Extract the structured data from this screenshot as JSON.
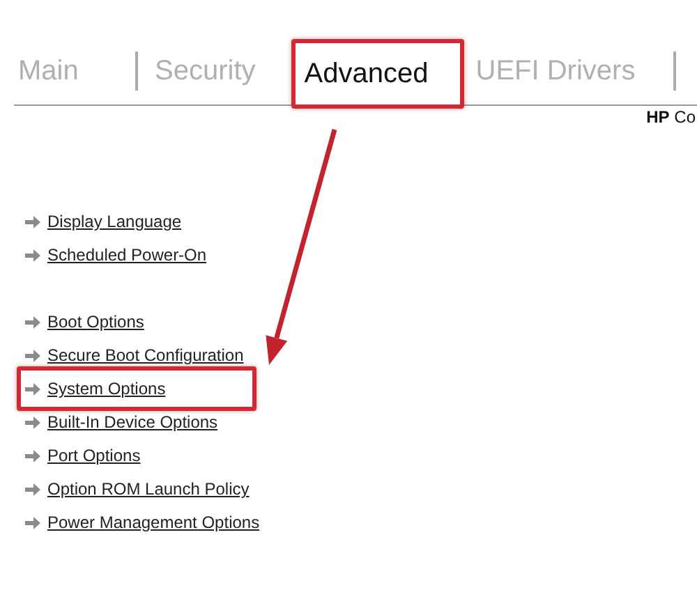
{
  "tabs": [
    {
      "label": "Main",
      "selected": false
    },
    {
      "label": "Security",
      "selected": false
    },
    {
      "label": "Advanced",
      "selected": true
    },
    {
      "label": "UEFI Drivers",
      "selected": false
    }
  ],
  "product": "**HP** Co",
  "menu_groups": [
    [
      {
        "label": "Display Language",
        "highlighted": false
      },
      {
        "label": "Scheduled Power-On",
        "highlighted": false
      }
    ],
    [
      {
        "label": "Boot Options",
        "highlighted": false
      },
      {
        "label": "Secure Boot Configuration",
        "highlighted": false
      },
      {
        "label": "System Options",
        "highlighted": true
      },
      {
        "label": "Built-In Device Options",
        "highlighted": false
      },
      {
        "label": "Port Options",
        "highlighted": false
      },
      {
        "label": "Option ROM Launch Policy",
        "highlighted": false
      },
      {
        "label": "Power Management Options",
        "highlighted": false
      }
    ]
  ]
}
